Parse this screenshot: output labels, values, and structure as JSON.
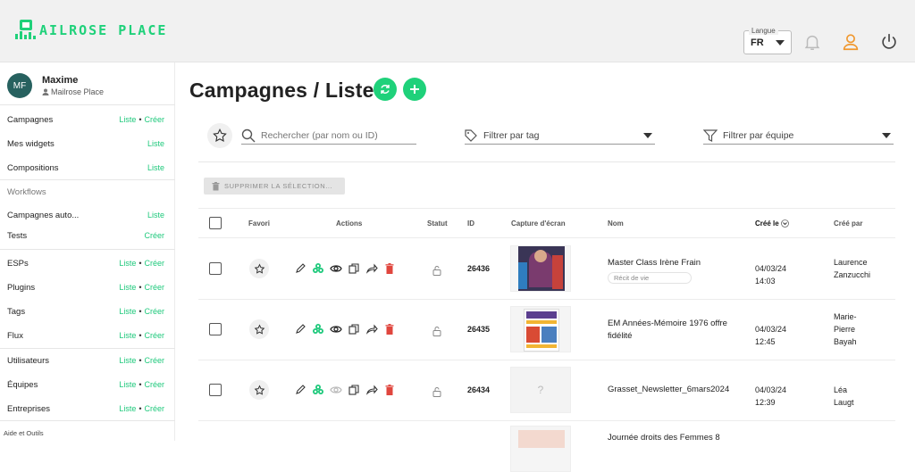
{
  "brand": {
    "logo_text": "AILROSE PLACE",
    "accent": "#1fd17a"
  },
  "header": {
    "language_label": "Langue",
    "language_value": "FR",
    "icons": [
      "bell-icon",
      "user-icon",
      "power-icon"
    ]
  },
  "user": {
    "initials": "MF",
    "name": "Maxime",
    "company": "Mailrose Place"
  },
  "sidebar": {
    "items": [
      {
        "label": "Campagnes",
        "links": [
          "Liste",
          "Créer"
        ]
      },
      {
        "label": "Mes widgets",
        "links": [
          "Liste"
        ]
      },
      {
        "label": "Compositions",
        "links": [
          "Liste"
        ]
      }
    ],
    "workflows_title": "Workflows",
    "workflow_items": [
      {
        "label": "Campagnes auto...",
        "links": [
          "Liste"
        ]
      },
      {
        "label": "Tests",
        "links": [
          "Créer"
        ]
      }
    ],
    "group2": [
      {
        "label": "ESPs",
        "links": [
          "Liste",
          "Créer"
        ]
      },
      {
        "label": "Plugins",
        "links": [
          "Liste",
          "Créer"
        ]
      },
      {
        "label": "Tags",
        "links": [
          "Liste",
          "Créer"
        ]
      },
      {
        "label": "Flux",
        "links": [
          "Liste",
          "Créer"
        ]
      }
    ],
    "group3": [
      {
        "label": "Utilisateurs",
        "links": [
          "Liste",
          "Créer"
        ]
      },
      {
        "label": "Équipes",
        "links": [
          "Liste",
          "Créer"
        ]
      },
      {
        "label": "Entreprises",
        "links": [
          "Liste",
          "Créer"
        ]
      }
    ],
    "footer": "Aide et Outils"
  },
  "main": {
    "title": "Campagnes / Liste",
    "search_placeholder": "Rechercher (par nom ou ID)",
    "tag_filter": "Filtrer par tag",
    "team_filter": "Filtrer par équipe",
    "delete_selection": "SUPPRIMER LA SÉLECTION..."
  },
  "table": {
    "headers": {
      "favori": "Favori",
      "actions": "Actions",
      "statut": "Statut",
      "id": "ID",
      "capture": "Capture d'écran",
      "nom": "Nom",
      "cree_le": "Créé le",
      "cree_par": "Créé par"
    },
    "rows": [
      {
        "id": "26436",
        "name": "Master Class Irène Frain",
        "tag": "Récit de vie",
        "date": "04/03/24 14:03",
        "author": [
          "Laurence",
          "Zanzucchi"
        ],
        "thumb": "photo"
      },
      {
        "id": "26435",
        "name": [
          "EM Années-Mémoire 1976 offre",
          "fidélité"
        ],
        "tag": "",
        "date": "04/03/24 12:45",
        "author": [
          "Marie-",
          "Pierre",
          "Bayah"
        ],
        "thumb": "flyer"
      },
      {
        "id": "26434",
        "name": "Grasset_Newsletter_6mars2024",
        "tag": "",
        "date": "04/03/24 12:39",
        "author": [
          "Léa Laugt"
        ],
        "thumb": "placeholder",
        "placeholder_glyph": "?"
      },
      {
        "id": "",
        "name": "Journée droits des Femmes 8",
        "tag": "",
        "date": "",
        "author": [],
        "thumb": "partial"
      }
    ]
  }
}
